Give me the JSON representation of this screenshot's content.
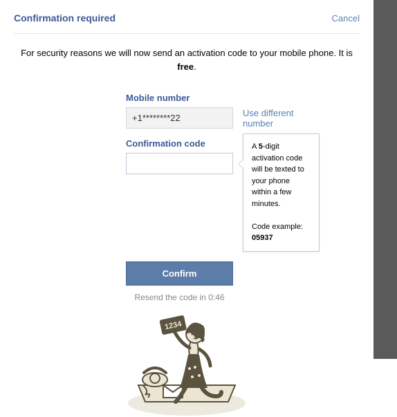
{
  "header": {
    "title": "Confirmation required",
    "cancel": "Cancel"
  },
  "message": {
    "line": "For security reasons we will now send an activation code to your mobile phone. It is",
    "bold": "free"
  },
  "labels": {
    "mobile": "Mobile number",
    "code": "Confirmation code"
  },
  "fields": {
    "mobile_value": "+1********22",
    "different_number": "Use different number",
    "code_value": ""
  },
  "tooltip": {
    "prefix": "A ",
    "digits": "5",
    "mid": "-digit activation code will be texted to your phone within a few minutes.",
    "example_label": "Code example: ",
    "example_code": "05937"
  },
  "buttons": {
    "confirm": "Confirm"
  },
  "resend": {
    "prefix": "Resend the code in ",
    "time": "0:46"
  },
  "illustration": {
    "badge_text": "1234"
  }
}
